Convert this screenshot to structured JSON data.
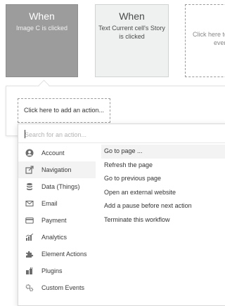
{
  "events": [
    {
      "title": "When",
      "subtitle": "Image C is clicked"
    },
    {
      "title": "When",
      "subtitle": "Text Current cell's Story is clicked"
    },
    {
      "title": "",
      "subtitle": "Click here to",
      "subtitle2": "ever"
    }
  ],
  "workflow": {
    "add_action_label": "Click here to add an action..."
  },
  "picker": {
    "search_placeholder": "Search for an action...",
    "categories": [
      {
        "label": "Account",
        "icon": "user-circle-icon"
      },
      {
        "label": "Navigation",
        "icon": "navigation-arrow-icon"
      },
      {
        "label": "Data (Things)",
        "icon": "database-icon"
      },
      {
        "label": "Email",
        "icon": "envelope-icon"
      },
      {
        "label": "Payment",
        "icon": "credit-card-icon"
      },
      {
        "label": "Analytics",
        "icon": "bar-chart-icon"
      },
      {
        "label": "Element Actions",
        "icon": "puzzle-icon"
      },
      {
        "label": "Plugins",
        "icon": "plugin-icon"
      },
      {
        "label": "Custom Events",
        "icon": "gears-icon"
      }
    ],
    "active_category": "Navigation",
    "actions": [
      "Go to page ...",
      "Refresh the page",
      "Go to previous page",
      "Open an external website",
      "Add a pause before next action",
      "Terminate this workflow"
    ]
  },
  "colors": {
    "active_card": "#9c9c9c",
    "card_light": "#eff1f1",
    "icon": "#6d6d6d"
  }
}
